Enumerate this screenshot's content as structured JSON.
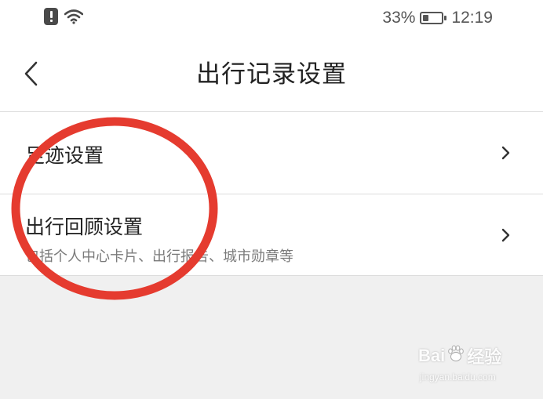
{
  "status_bar": {
    "battery_percent_label": "33%",
    "battery_level": 0.33,
    "time": "12:19",
    "icons": [
      "alert-icon",
      "wifi-icon",
      "battery-icon"
    ]
  },
  "header": {
    "title": "出行记录设置",
    "back_icon": "chevron-left-icon"
  },
  "settings": {
    "items": [
      {
        "title": "足迹设置",
        "subtitle": ""
      },
      {
        "title": "出行回顾设置",
        "subtitle": "包括个人中心卡片、出行报告、城市勋章等"
      }
    ]
  },
  "annotation": {
    "circle_color": "#e53b2f"
  },
  "watermark": {
    "logo_left": "Bai",
    "logo_right": "经验",
    "url": "jingyan.baidu.com"
  },
  "colors": {
    "page_background": "#f0f0f0",
    "card_background": "#ffffff",
    "divider": "#dcdcdc",
    "primary_text": "#222222",
    "secondary_text": "#7a7a7a"
  }
}
